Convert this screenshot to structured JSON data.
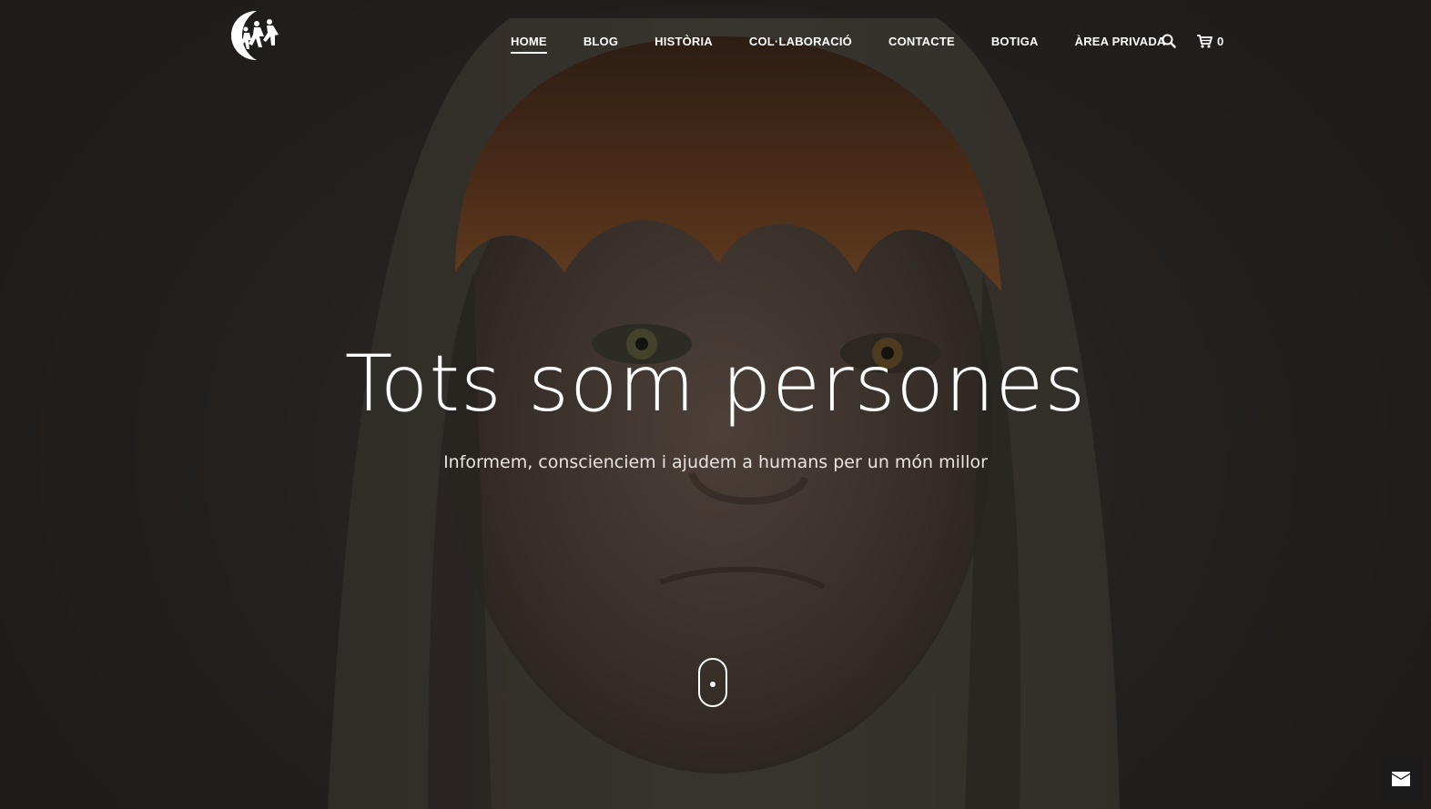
{
  "header": {
    "logo_icon": "refugees-running-logo",
    "nav": [
      {
        "label": "HOME",
        "active": true
      },
      {
        "label": "BLOG",
        "active": false
      },
      {
        "label": "HISTÒRIA",
        "active": false
      },
      {
        "label": "COL·LABORACIÓ",
        "active": false
      },
      {
        "label": "CONTACTE",
        "active": false
      },
      {
        "label": "BOTIGA",
        "active": false
      },
      {
        "label": "ÀREA PRIVADA",
        "active": false
      }
    ],
    "search_icon": "search-icon",
    "cart_icon": "cart-icon",
    "cart_count": "0"
  },
  "hero": {
    "title": "Tots som persones",
    "subtitle": "Informem, conscienciem i ajudem a humans per un món millor",
    "scroll_icon": "mouse-scroll-icon"
  },
  "contact_button": {
    "icon": "envelope-icon"
  },
  "colors": {
    "text": "#ffffff",
    "background": "#2a2724",
    "contact_button_bg": "#1b1b1b"
  }
}
